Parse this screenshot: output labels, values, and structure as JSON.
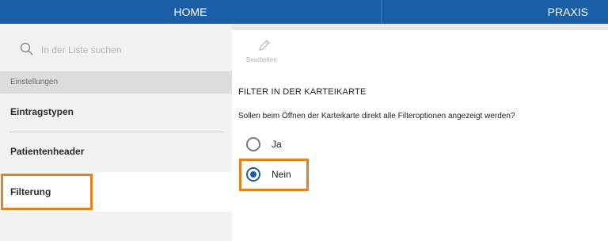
{
  "nav": {
    "tabs": [
      {
        "label": "HOME"
      },
      {
        "label": "PRAXIS"
      }
    ]
  },
  "sidebar": {
    "search": {
      "placeholder": "In der Liste suchen",
      "icon": "search-icon"
    },
    "section_header": "Einstellungen",
    "items": [
      {
        "label": "Eintragstypen"
      },
      {
        "label": "Patientenheader"
      },
      {
        "label": "Filterung",
        "selected": true
      }
    ]
  },
  "toolbar": {
    "edit_label": "Bearbeiten",
    "edit_icon": "pencil-icon"
  },
  "main": {
    "title": "FILTER IN DER KARTEIKARTE",
    "question": "Sollen beim Öffnen der Karteikarte direkt alle Filteroptionen angezeigt werden?",
    "options": [
      {
        "label": "Ja",
        "selected": false
      },
      {
        "label": "Nein",
        "selected": true
      }
    ]
  },
  "colors": {
    "accent": "#1a5ea8",
    "highlight": "#e87f1e"
  }
}
